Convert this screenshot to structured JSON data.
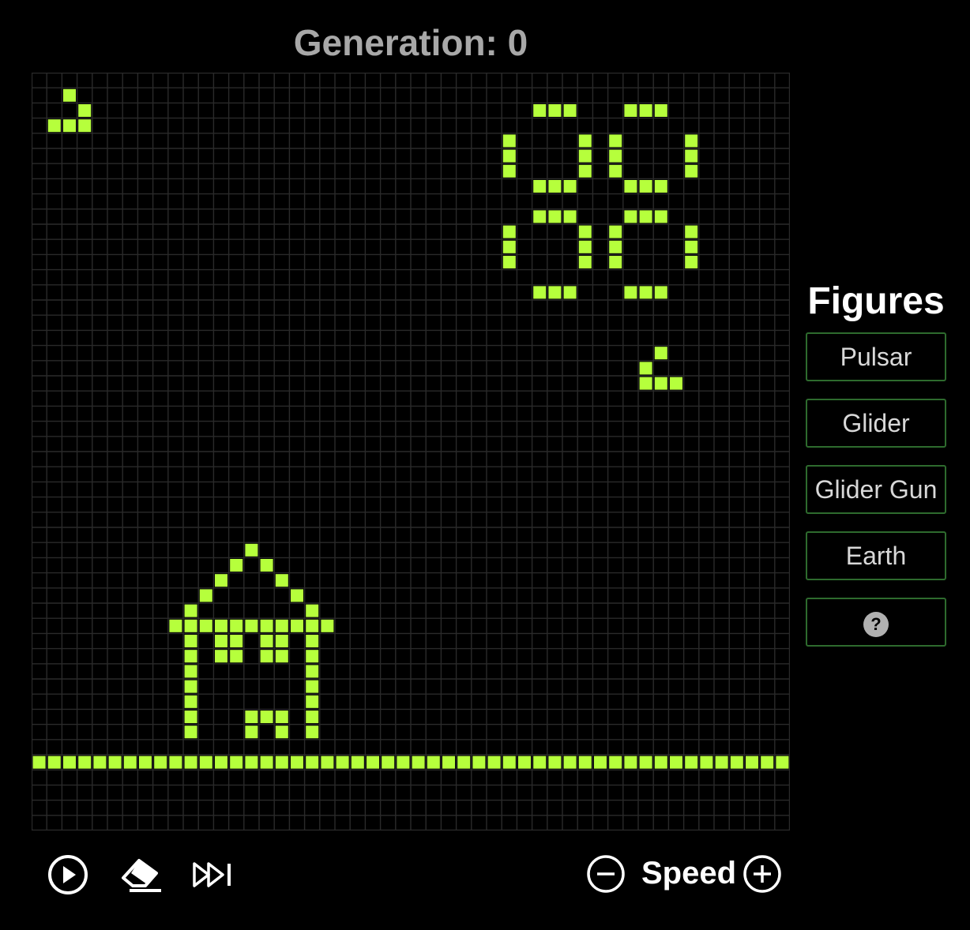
{
  "header": {
    "generation_label": "Generation: 0"
  },
  "board": {
    "rows": 50,
    "cols": 50,
    "colors": {
      "background": "#000000",
      "grid_line": "#2a2a2a",
      "alive": "#b6ff3c"
    },
    "alive_cells": [
      [
        1,
        2
      ],
      [
        2,
        3
      ],
      [
        3,
        1
      ],
      [
        3,
        2
      ],
      [
        3,
        3
      ],
      [
        2,
        33
      ],
      [
        2,
        34
      ],
      [
        2,
        35
      ],
      [
        2,
        39
      ],
      [
        2,
        40
      ],
      [
        2,
        41
      ],
      [
        4,
        31
      ],
      [
        4,
        36
      ],
      [
        4,
        38
      ],
      [
        4,
        43
      ],
      [
        5,
        31
      ],
      [
        5,
        36
      ],
      [
        5,
        38
      ],
      [
        5,
        43
      ],
      [
        6,
        31
      ],
      [
        6,
        36
      ],
      [
        6,
        38
      ],
      [
        6,
        43
      ],
      [
        7,
        33
      ],
      [
        7,
        34
      ],
      [
        7,
        35
      ],
      [
        7,
        39
      ],
      [
        7,
        40
      ],
      [
        7,
        41
      ],
      [
        9,
        33
      ],
      [
        9,
        34
      ],
      [
        9,
        35
      ],
      [
        9,
        39
      ],
      [
        9,
        40
      ],
      [
        9,
        41
      ],
      [
        10,
        31
      ],
      [
        10,
        36
      ],
      [
        10,
        38
      ],
      [
        10,
        43
      ],
      [
        11,
        31
      ],
      [
        11,
        36
      ],
      [
        11,
        38
      ],
      [
        11,
        43
      ],
      [
        12,
        31
      ],
      [
        12,
        36
      ],
      [
        12,
        38
      ],
      [
        12,
        43
      ],
      [
        14,
        33
      ],
      [
        14,
        34
      ],
      [
        14,
        35
      ],
      [
        14,
        39
      ],
      [
        14,
        40
      ],
      [
        14,
        41
      ],
      [
        18,
        41
      ],
      [
        19,
        40
      ],
      [
        20,
        40
      ],
      [
        20,
        41
      ],
      [
        20,
        42
      ],
      [
        31,
        14
      ],
      [
        32,
        13
      ],
      [
        32,
        15
      ],
      [
        33,
        12
      ],
      [
        33,
        16
      ],
      [
        34,
        11
      ],
      [
        34,
        17
      ],
      [
        35,
        10
      ],
      [
        35,
        18
      ],
      [
        36,
        9
      ],
      [
        36,
        10
      ],
      [
        36,
        11
      ],
      [
        36,
        12
      ],
      [
        36,
        13
      ],
      [
        36,
        14
      ],
      [
        36,
        15
      ],
      [
        36,
        16
      ],
      [
        36,
        17
      ],
      [
        36,
        18
      ],
      [
        36,
        19
      ],
      [
        37,
        10
      ],
      [
        37,
        18
      ],
      [
        38,
        10
      ],
      [
        38,
        18
      ],
      [
        39,
        10
      ],
      [
        39,
        18
      ],
      [
        40,
        10
      ],
      [
        40,
        18
      ],
      [
        41,
        10
      ],
      [
        41,
        18
      ],
      [
        42,
        10
      ],
      [
        42,
        18
      ],
      [
        43,
        10
      ],
      [
        43,
        18
      ],
      [
        37,
        12
      ],
      [
        37,
        13
      ],
      [
        38,
        12
      ],
      [
        38,
        13
      ],
      [
        37,
        15
      ],
      [
        37,
        16
      ],
      [
        38,
        15
      ],
      [
        38,
        16
      ],
      [
        42,
        14
      ],
      [
        42,
        15
      ],
      [
        42,
        16
      ],
      [
        43,
        14
      ],
      [
        43,
        16
      ],
      [
        45,
        0
      ],
      [
        45,
        1
      ],
      [
        45,
        2
      ],
      [
        45,
        3
      ],
      [
        45,
        4
      ],
      [
        45,
        5
      ],
      [
        45,
        6
      ],
      [
        45,
        7
      ],
      [
        45,
        8
      ],
      [
        45,
        9
      ],
      [
        45,
        10
      ],
      [
        45,
        11
      ],
      [
        45,
        12
      ],
      [
        45,
        13
      ],
      [
        45,
        14
      ],
      [
        45,
        15
      ],
      [
        45,
        16
      ],
      [
        45,
        17
      ],
      [
        45,
        18
      ],
      [
        45,
        19
      ],
      [
        45,
        20
      ],
      [
        45,
        21
      ],
      [
        45,
        22
      ],
      [
        45,
        23
      ],
      [
        45,
        24
      ],
      [
        45,
        25
      ],
      [
        45,
        26
      ],
      [
        45,
        27
      ],
      [
        45,
        28
      ],
      [
        45,
        29
      ],
      [
        45,
        30
      ],
      [
        45,
        31
      ],
      [
        45,
        32
      ],
      [
        45,
        33
      ],
      [
        45,
        34
      ],
      [
        45,
        35
      ],
      [
        45,
        36
      ],
      [
        45,
        37
      ],
      [
        45,
        38
      ],
      [
        45,
        39
      ],
      [
        45,
        40
      ],
      [
        45,
        41
      ],
      [
        45,
        42
      ],
      [
        45,
        43
      ],
      [
        45,
        44
      ],
      [
        45,
        45
      ],
      [
        45,
        46
      ],
      [
        45,
        47
      ],
      [
        45,
        48
      ],
      [
        45,
        49
      ]
    ]
  },
  "controls": {
    "play_icon": "play-circle-icon",
    "clear_icon": "eraser-icon",
    "step_icon": "fast-forward-icon",
    "speed_down_icon": "minus-circle-icon",
    "speed_label": "Speed",
    "speed_up_icon": "plus-circle-icon"
  },
  "sidebar": {
    "title": "Figures",
    "buttons": [
      {
        "label": "Pulsar"
      },
      {
        "label": "Glider"
      },
      {
        "label": "Glider Gun"
      },
      {
        "label": "Earth"
      },
      {
        "label": "?",
        "icon": "help-icon"
      }
    ],
    "accent": "#2e6b2e"
  }
}
